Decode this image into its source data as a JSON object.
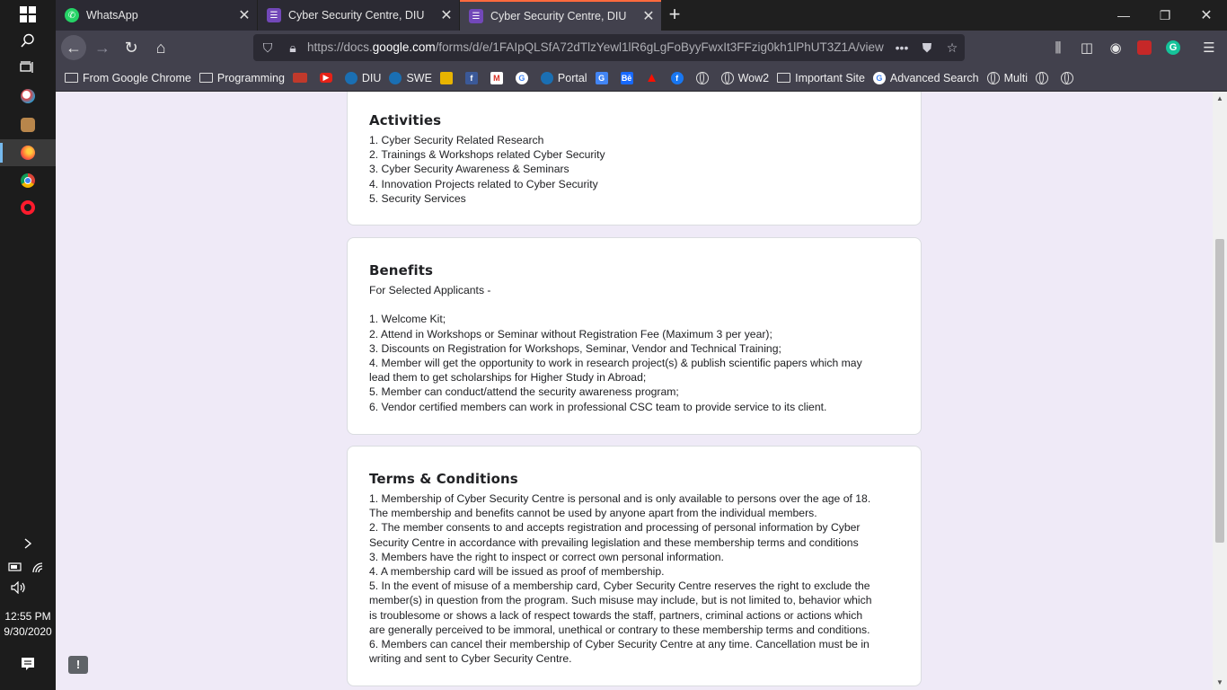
{
  "taskbar": {
    "time": "12:55 PM",
    "date": "9/30/2020"
  },
  "tabs": [
    {
      "label": "WhatsApp",
      "icon": "whatsapp-icon"
    },
    {
      "label": "Cyber Security Centre, DIU",
      "icon": "google-forms-icon"
    },
    {
      "label": "Cyber Security Centre, DIU",
      "icon": "google-forms-icon"
    }
  ],
  "urlbar": {
    "prefix": "https://docs.",
    "domain": "google.com",
    "path": "/forms/d/e/1FAIpQLSfA72dTlzYewl1lR6gLgFoByyFwxIt3FFzig0kh1lPhUT3Z1A/view"
  },
  "bookmarks": [
    {
      "label": "From Google Chrome",
      "icon": "folder-icon"
    },
    {
      "label": "Programming",
      "icon": "folder-icon"
    },
    {
      "label": "",
      "icon": "hd-icon",
      "color": "#c0392b"
    },
    {
      "label": "",
      "icon": "youtube-icon",
      "color": "#e62117"
    },
    {
      "label": "DIU",
      "icon": "diu-icon",
      "color": "#1a6fb3"
    },
    {
      "label": "SWE",
      "icon": "swe-icon",
      "color": "#1a6fb3"
    },
    {
      "label": "",
      "icon": "photo-icon",
      "color": "#e8b400"
    },
    {
      "label": "",
      "icon": "facebook-icon",
      "color": "#3b5998"
    },
    {
      "label": "",
      "icon": "gmail-icon",
      "color": "#d93025"
    },
    {
      "label": "",
      "icon": "google-icon",
      "color": "#4285f4"
    },
    {
      "label": "Portal",
      "icon": "portal-icon",
      "color": "#1a6fb3"
    },
    {
      "label": "",
      "icon": "translate-icon",
      "color": "#4285f4"
    },
    {
      "label": "",
      "icon": "behance-icon",
      "color": "#1769ff"
    },
    {
      "label": "",
      "icon": "adobe-icon",
      "color": "#fa0f00"
    },
    {
      "label": "",
      "icon": "facebook-round-icon",
      "color": "#1877f2"
    },
    {
      "label": "",
      "icon": "globe-icon"
    },
    {
      "label": "Wow2",
      "icon": "globe-icon"
    },
    {
      "label": "Important Site",
      "icon": "folder-icon"
    },
    {
      "label": "Advanced Search",
      "icon": "google-icon",
      "color": "#4285f4"
    },
    {
      "label": "Multi",
      "icon": "globe-icon"
    },
    {
      "label": "",
      "icon": "globe-icon"
    },
    {
      "label": "",
      "icon": "globe-icon"
    }
  ],
  "activities": {
    "title": "Activities",
    "lines": [
      "1. Cyber Security Related Research",
      "2. Trainings & Workshops related Cyber Security",
      "3. Cyber Security Awareness & Seminars",
      "4. Innovation Projects related to Cyber Security",
      "5. Security Services"
    ]
  },
  "benefits": {
    "title": "Benefits",
    "intro": "For Selected Applicants -",
    "lines": [
      "1. Welcome Kit;",
      "2. Attend in Workshops or Seminar without Registration Fee (Maximum 3 per year);",
      "3. Discounts on Registration for Workshops, Seminar, Vendor and Technical Training;",
      "4. Member will get the opportunity to work in research project(s) & publish scientific papers which may",
      "lead them to get scholarships for Higher Study in Abroad;",
      "5. Member can conduct/attend the security awareness program;",
      "6. Vendor certified members can work in professional CSC team to provide service to its client."
    ]
  },
  "terms": {
    "title": "Terms & Conditions",
    "lines": [
      "1. Membership of Cyber Security Centre is personal and is only available to persons over the age of 18.",
      "The membership and benefits cannot be used by anyone apart from the individual members.",
      "2. The member consents to and accepts registration and processing of personal information by Cyber",
      "Security Centre in accordance with prevailing legislation and these membership terms and conditions",
      "3. Members have the right to inspect or correct own personal information.",
      "4. A membership card will be issued as proof of membership.",
      "5. In the event of misuse of a membership card, Cyber Security Centre reserves the right to exclude the",
      "member(s) in question from the program. Such misuse may include, but is not limited to, behavior which",
      "is troublesome or shows a lack of respect towards the staff, partners, criminal actions or actions which",
      "are generally perceived to be immoral, unethical or contrary to these membership terms and conditions.",
      "6. Members can cancel their membership of Cyber Security Centre at any time. Cancellation must be in",
      "writing and sent to Cyber Security Centre."
    ]
  },
  "colors": {
    "tab_accent": "#ff6a3d",
    "page_bg": "#efeaf7",
    "forms_purple": "#7248b9"
  }
}
